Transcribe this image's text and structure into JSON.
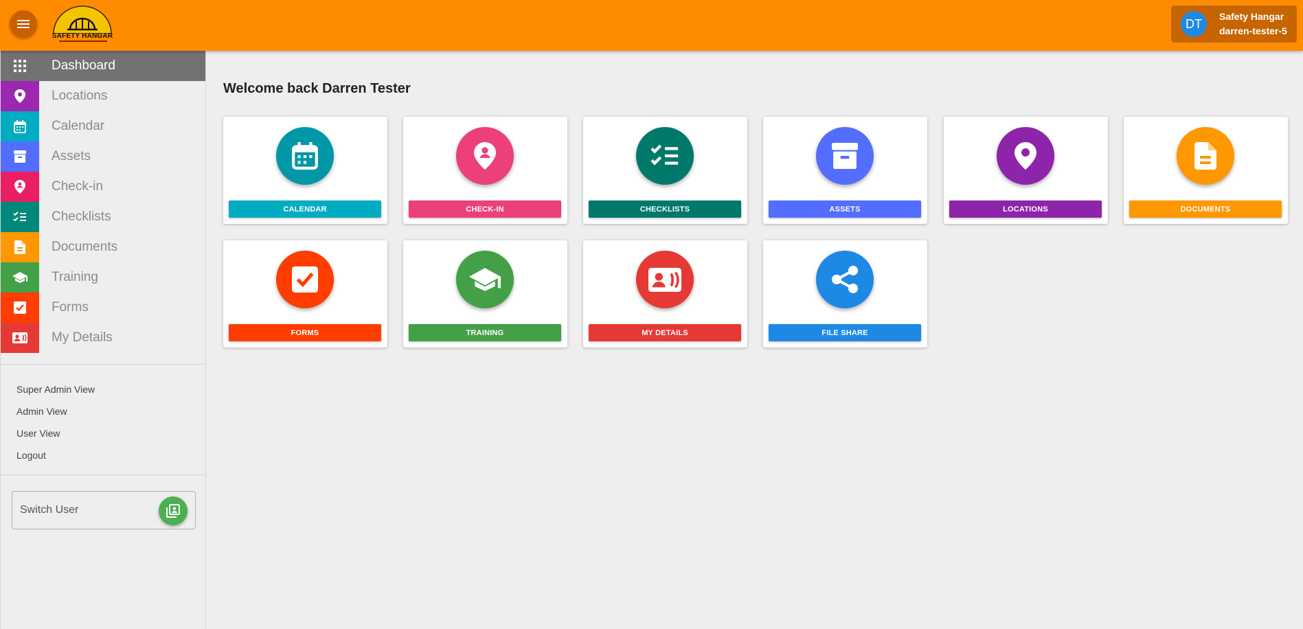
{
  "header": {
    "logo_text": "SAFETY HANGAR",
    "user": {
      "initials": "DT",
      "org": "Safety Hangar",
      "username": "darren-tester-5"
    },
    "colors": {
      "bar": "#ff8c00",
      "chip": "#c76500",
      "avatar": "#1e88e5"
    }
  },
  "sidebar": {
    "items": [
      {
        "label": "Dashboard",
        "icon": "grid-icon",
        "color": "#727272",
        "active": true
      },
      {
        "label": "Locations",
        "icon": "map-pin-icon",
        "color": "#9c27b0"
      },
      {
        "label": "Calendar",
        "icon": "calendar-icon",
        "color": "#00acc1"
      },
      {
        "label": "Assets",
        "icon": "archive-box-icon",
        "color": "#536dfe"
      },
      {
        "label": "Check-in",
        "icon": "checkin-pin-icon",
        "color": "#e91e63"
      },
      {
        "label": "Checklists",
        "icon": "checklist-icon",
        "color": "#00897b"
      },
      {
        "label": "Documents",
        "icon": "document-icon",
        "color": "#ff9800"
      },
      {
        "label": "Training",
        "icon": "graduation-cap-icon",
        "color": "#43a047"
      },
      {
        "label": "Forms",
        "icon": "checkbox-icon",
        "color": "#ff3d00"
      },
      {
        "label": "My Details",
        "icon": "contact-card-icon",
        "color": "#e53935"
      }
    ],
    "views": [
      "Super Admin View",
      "Admin View",
      "User View",
      "Logout"
    ],
    "switch_user": "Switch User"
  },
  "main": {
    "welcome": "Welcome back Darren Tester",
    "tiles": [
      {
        "label": "CALENDAR",
        "icon": "calendar-icon",
        "circle": "#0097a7",
        "button": "#00acc1"
      },
      {
        "label": "CHECK-IN",
        "icon": "checkin-pin-icon",
        "circle": "#ec407a",
        "button": "#ec407a"
      },
      {
        "label": "CHECKLISTS",
        "icon": "checklist-icon",
        "circle": "#00796b",
        "button": "#00796b"
      },
      {
        "label": "ASSETS",
        "icon": "archive-box-icon",
        "circle": "#536dfe",
        "button": "#536dfe"
      },
      {
        "label": "LOCATIONS",
        "icon": "map-pin-icon",
        "circle": "#8e24aa",
        "button": "#8e24aa"
      },
      {
        "label": "DOCUMENTS",
        "icon": "document-icon",
        "circle": "#ff9800",
        "button": "#ff9800"
      },
      {
        "label": "FORMS",
        "icon": "checkbox-icon",
        "circle": "#ff3d00",
        "button": "#ff3d00"
      },
      {
        "label": "TRAINING",
        "icon": "graduation-cap-icon",
        "circle": "#43a047",
        "button": "#43a047"
      },
      {
        "label": "MY DETAILS",
        "icon": "contact-card-icon",
        "circle": "#e53935",
        "button": "#e53935"
      },
      {
        "label": "FILE SHARE",
        "icon": "share-icon",
        "circle": "#1e88e5",
        "button": "#1e88e5"
      }
    ]
  }
}
